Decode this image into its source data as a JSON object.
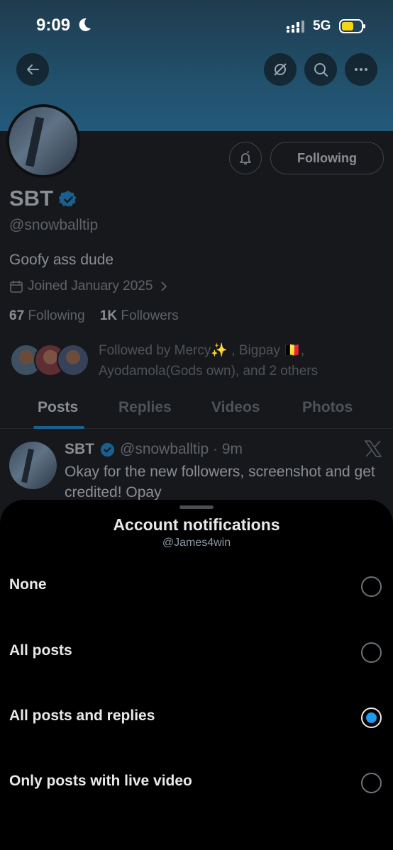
{
  "status_bar": {
    "time": "9:09",
    "network": "5G"
  },
  "profile": {
    "display_name": "SBT",
    "handle": "@snowballtip",
    "bio": "Goofy ass dude",
    "joined": "Joined January 2025",
    "following_count": "67",
    "following_label": "Following",
    "followers_count": "1K",
    "followers_label": "Followers",
    "followed_by": "Followed by Mercy✨ , Bigpay 🇧🇪, Ayodamola(Gods own), and 2 others",
    "follow_button": "Following"
  },
  "tabs": [
    {
      "label": "Posts",
      "active": true
    },
    {
      "label": "Replies",
      "active": false
    },
    {
      "label": "Videos",
      "active": false
    },
    {
      "label": "Photos",
      "active": false
    }
  ],
  "post": {
    "name": "SBT",
    "handle_time": "@snowballtip · 9m",
    "text": "Okay for the new followers, screenshot and get credited! Opay"
  },
  "sheet": {
    "title": "Account notifications",
    "subtitle": "@James4win",
    "options": [
      {
        "label": "None",
        "selected": false
      },
      {
        "label": "All posts",
        "selected": false
      },
      {
        "label": "All posts and replies",
        "selected": true
      },
      {
        "label": "Only posts with live video",
        "selected": false
      }
    ]
  },
  "colors": {
    "accent": "#1d9bf0",
    "banner": "#21506b",
    "sheet_bg": "#000000"
  }
}
